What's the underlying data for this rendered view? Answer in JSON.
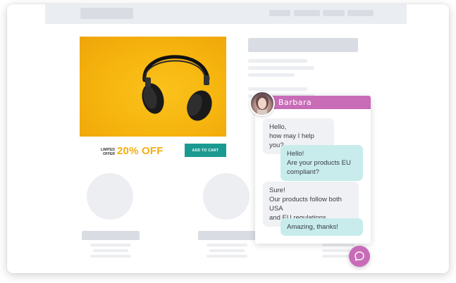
{
  "product": {
    "offer_line1": "LIMITED",
    "offer_line2": "OFFER",
    "discount": "20% OFF",
    "cart_button": "ADD TO CART"
  },
  "chat": {
    "agent_name": "Barbara",
    "messages": [
      {
        "from": "agent",
        "text": "Hello,\nhow may I help you?"
      },
      {
        "from": "user",
        "text": "Hello!\nAre your products EU\ncompliant?"
      },
      {
        "from": "agent",
        "text": "Sure!\nOur products follow both USA\nand EU regulations."
      },
      {
        "from": "user",
        "text": "Amazing, thanks!"
      }
    ]
  },
  "icons": {
    "product_image": "headphones-icon",
    "fab": "chat-bubble-icon",
    "avatar": "agent-avatar"
  },
  "colors": {
    "accent_pink": "#c86cb7",
    "discount_yellow": "#f5ae10",
    "cart_teal": "#1b9a92",
    "user_bubble": "#c8ecec",
    "agent_bubble": "#f0f1f4"
  }
}
